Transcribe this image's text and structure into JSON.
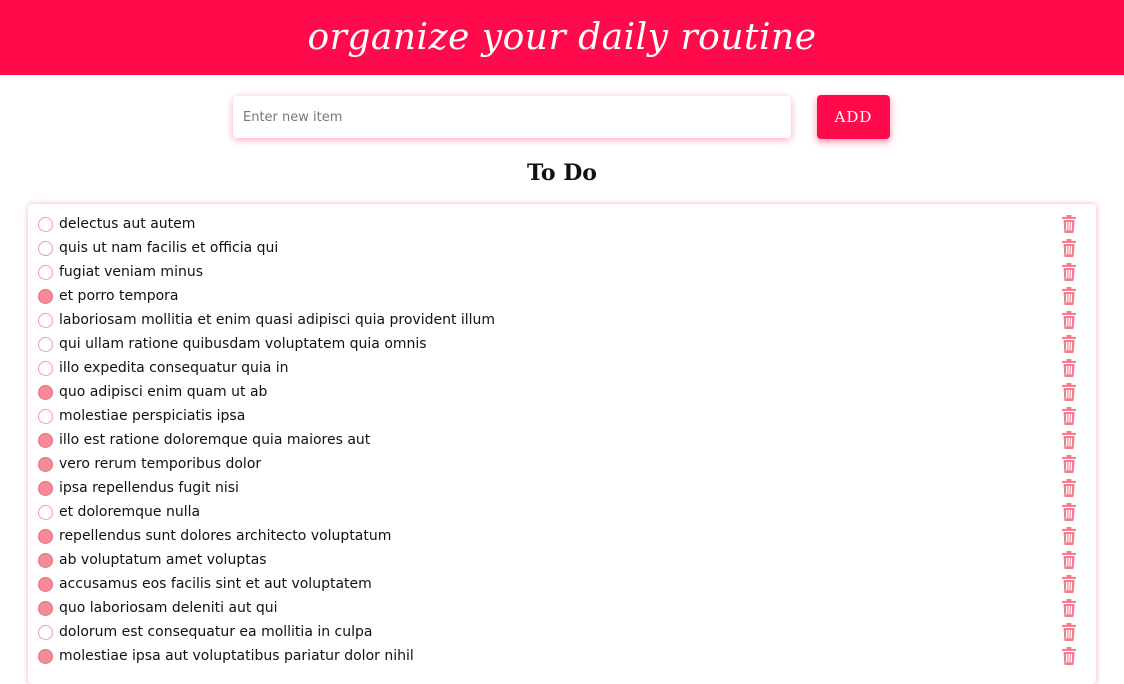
{
  "header": {
    "title": "organize your daily routine"
  },
  "add_form": {
    "placeholder": "Enter new item",
    "button_label": "ADD"
  },
  "list": {
    "title": "To Do",
    "items": [
      {
        "text": "delectus aut autem",
        "done": false
      },
      {
        "text": "quis ut nam facilis et officia qui",
        "done": false
      },
      {
        "text": "fugiat veniam minus",
        "done": false
      },
      {
        "text": "et porro tempora",
        "done": true
      },
      {
        "text": "laboriosam mollitia et enim quasi adipisci quia provident illum",
        "done": false
      },
      {
        "text": "qui ullam ratione quibusdam voluptatem quia omnis",
        "done": false
      },
      {
        "text": "illo expedita consequatur quia in",
        "done": false
      },
      {
        "text": "quo adipisci enim quam ut ab",
        "done": true
      },
      {
        "text": "molestiae perspiciatis ipsa",
        "done": false
      },
      {
        "text": "illo est ratione doloremque quia maiores aut",
        "done": true
      },
      {
        "text": "vero rerum temporibus dolor",
        "done": true
      },
      {
        "text": "ipsa repellendus fugit nisi",
        "done": true
      },
      {
        "text": "et doloremque nulla",
        "done": false
      },
      {
        "text": "repellendus sunt dolores architecto voluptatum",
        "done": true
      },
      {
        "text": "ab voluptatum amet voluptas",
        "done": true
      },
      {
        "text": "accusamus eos facilis sint et aut voluptatem",
        "done": true
      },
      {
        "text": "quo laboriosam deleniti aut qui",
        "done": true
      },
      {
        "text": "dolorum est consequatur ea mollitia in culpa",
        "done": false
      },
      {
        "text": "molestiae ipsa aut voluptatibus pariatur dolor nihil",
        "done": true
      }
    ]
  },
  "icons": {
    "delete": "trash-icon",
    "status": "radio-circle-icon"
  },
  "colors": {
    "accent": "#ff0a4a",
    "done_fill": "#f58a99",
    "outline": "#f59aa8",
    "trash": "#f47c8e"
  }
}
